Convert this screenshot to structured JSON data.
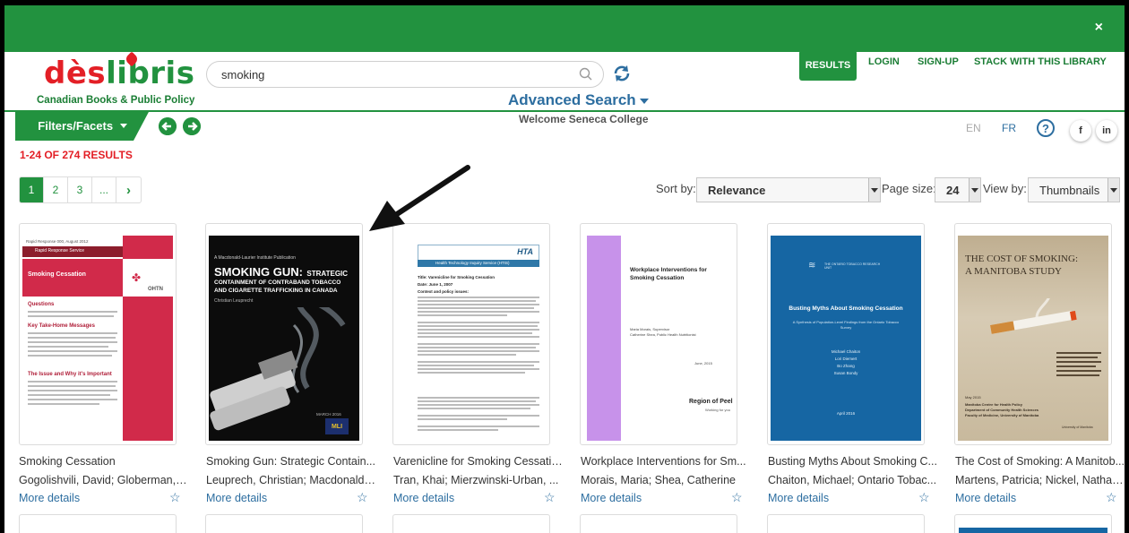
{
  "header": {
    "close_label": "×",
    "logo_part1": "dès",
    "logo_part2": "libris",
    "tagline": "Canadian Books & Public Policy",
    "search_value": "smoking",
    "advanced_search": "Advanced Search",
    "welcome": "Welcome Seneca College"
  },
  "nav": {
    "results": "RESULTS",
    "login": "LOGIN",
    "signup": "SIGN-UP",
    "stack": "STACK WITH THIS LIBRARY"
  },
  "filters": {
    "label": "Filters/Facets"
  },
  "lang": {
    "en": "EN",
    "fr": "FR",
    "help": "?",
    "facebook": "f",
    "linkedin": "in"
  },
  "results": {
    "count": "1-24 OF 274 RESULTS",
    "pages": [
      "1",
      "2",
      "3",
      "...",
      "›"
    ],
    "sort_label": "Sort by:",
    "sort_value": "Relevance",
    "page_size_label": "Page size:",
    "page_size_value": "24",
    "view_label": "View by:",
    "view_value": "Thumbnails"
  },
  "colors": {
    "brand_green": "#22923f",
    "brand_red": "#e31f26",
    "link_blue": "#2d6ea0"
  },
  "items": [
    {
      "title": "Smoking Cessation",
      "authors": "Gogolishvili, David; Globerman, J...",
      "more": "More details",
      "cover": {
        "header": "Rapid Response 000, August 2012",
        "band": "Rapid Response Service",
        "title": "Smoking Cessation",
        "org": "OHTN",
        "section1": "Questions",
        "section2": "Key Take-Home Messages",
        "section3": "The Issue and Why it's Important"
      }
    },
    {
      "title": "Smoking Gun: Strategic Contain...",
      "authors": "Leuprech, Christian; Macdonald-...",
      "more": "More details",
      "cover": {
        "series": "A Macdonald-Laurier Institute Publication",
        "title": "SMOKING GUN:",
        "title2": "STRATEGIC",
        "subtitle1": "CONTAINMENT OF CONTRABAND TOBACCO",
        "subtitle2": "AND CIGARETTE TRAFFICKING IN CANADA",
        "author": "Christian Leuprecht",
        "date": "MARCH 2016",
        "logo": "MLI"
      }
    },
    {
      "title": "Varenicline for Smoking Cessation",
      "authors": "Tran, Khai; Mierzwinski-Urban, ...",
      "more": "More details",
      "cover": {
        "org": "HTA",
        "band": "Health Technology Inquiry Service (HTIS)",
        "line1": "Title:  Varenicline for Smoking Cessation",
        "line2": "Date:  June 1, 2007",
        "line3": "Context and policy issues:"
      }
    },
    {
      "title": "Workplace Interventions for Sm...",
      "authors": "Morais, Maria; Shea, Catherine",
      "more": "More details",
      "cover": {
        "title": "Workplace Interventions for Smoking Cessation",
        "author1": "Maria Morais, Supervisor",
        "author2": "Catherine Shea, Public Health Nutritionist",
        "date": "June, 2015",
        "org": "Region of Peel",
        "org_tag": "Working for you"
      }
    },
    {
      "title": "Busting Myths About Smoking C...",
      "authors": "Chaiton, Michael; Ontario Tobac...",
      "more": "More details",
      "cover": {
        "org": "THE ONTARIO TOBACCO RESEARCH UNIT",
        "title": "Busting Myths About Smoking Cessation",
        "subtitle": "A Synthesis of Population-Level Findings from the Ontario Tobacco Survey",
        "a1": "Michael Chaiton",
        "a2": "Lori Diemert",
        "a3": "Bo Zhang",
        "a4": "Susan Bondy",
        "date": "April 2016"
      }
    },
    {
      "title": "The Cost of Smoking: A Manitob...",
      "authors": "Martens, Patricia; Nickel, Nathan...",
      "more": "More details",
      "cover": {
        "title1": "THE COST OF SMOKING:",
        "title2": "A MANITOBA STUDY",
        "date": "May 2015",
        "center1": "Manitoba Centre for Health Policy",
        "center2": "Department of Community Health Sciences",
        "center3": "Faculty of Medicine, University of Manitoba",
        "uni": "University of Manitoba"
      }
    }
  ]
}
